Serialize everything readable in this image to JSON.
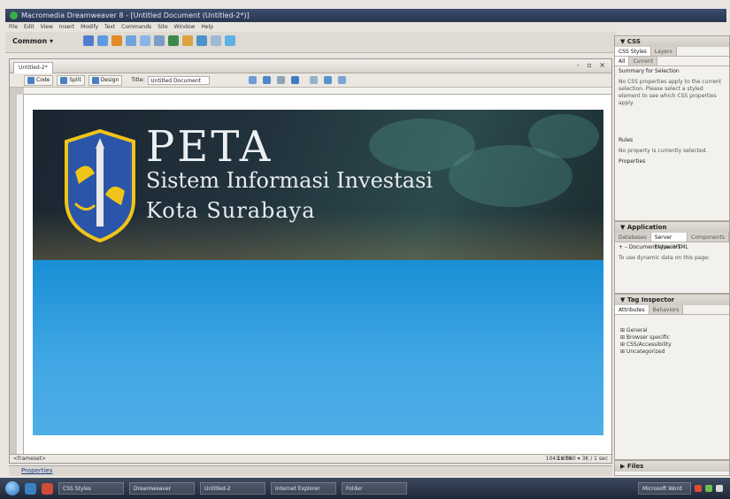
{
  "window": {
    "title": "Macromedia Dreamweaver 8 - [Untitled Document (Untitled-2*)]"
  },
  "menubar": {
    "items": [
      "File",
      "Edit",
      "View",
      "Insert",
      "Modify",
      "Text",
      "Commands",
      "Site",
      "Window",
      "Help"
    ]
  },
  "insert_toolbar": {
    "category": "Common ▾"
  },
  "document": {
    "tab_label": "Untitled-2*",
    "controls": "- ▫ ×",
    "view_code": "Code",
    "view_split": "Split",
    "view_design": "Design",
    "title_label": "Title:",
    "title_value": "Untitled Document",
    "status_tag": "<frameset>",
    "status_zoom": "100%",
    "status_dims": "1043 x 560 ▾ 3K / 1 sec"
  },
  "banner": {
    "title": "PETA",
    "subtitle1": "Sistem Informasi Investasi",
    "subtitle2": "Kota Surabaya"
  },
  "properties_bar": {
    "label": "Properties"
  },
  "panels": {
    "css": {
      "header": "▼ CSS",
      "tabs": [
        "CSS Styles",
        "Layers"
      ],
      "subtabs": [
        "All",
        "Current"
      ],
      "summary_heading": "Summary for Selection",
      "summary_text": "No CSS properties apply to the current selection. Please select a styled element to see which CSS properties apply.",
      "rules_heading": "Rules",
      "rules_text": "No property is currently selected.",
      "properties_heading": "Properties"
    },
    "application": {
      "header": "▼ Application",
      "tabs": [
        "Databases",
        "Server Behaviors",
        "Components"
      ],
      "item": "+  –  Document type: HTML",
      "text": "To use dynamic data on this page:"
    },
    "tag_inspector": {
      "header": "▼ Tag Inspector",
      "tabs": [
        "Attributes",
        "Behaviors"
      ],
      "items": [
        "⊞ General",
        "⊞ Browser specific",
        "⊞ CSS/Accessibility",
        "⊞ Uncategorized"
      ]
    },
    "files": {
      "header": "▶ Files"
    }
  },
  "taskbar": {
    "items": [
      "CSS Styles",
      "Dreamweaver",
      "Untitled-2",
      "Internet Explorer",
      "Folder"
    ],
    "tray_label": "Microsoft Word"
  },
  "colors": {
    "banner_blue": "#3fa6e4",
    "emblem_shield": "#2a55a8",
    "emblem_gold": "#f0c419"
  }
}
